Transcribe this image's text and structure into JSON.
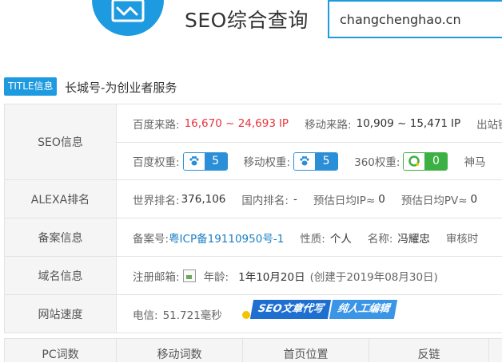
{
  "header": {
    "app_title": "SEO综合查询",
    "search_value": "changchenghao.cn"
  },
  "site": {
    "title_badge": "TITLE信息",
    "title": "长城号-为创业者服务"
  },
  "seo": {
    "label": "SEO信息",
    "baidu_source_label": "百度来路:",
    "baidu_source_value": "16,670 ~ 24,693",
    "baidu_source_unit": "IP",
    "mobile_source_label": "移动来路:",
    "mobile_source_value": "10,909 ~ 15,471",
    "mobile_source_unit": "IP",
    "exit_label": "出站链",
    "baidu_weight_label": "百度权重:",
    "baidu_weight_value": "5",
    "mobile_weight_label": "移动权重:",
    "mobile_weight_value": "5",
    "so360_weight_label": "360权重:",
    "so360_weight_value": "0",
    "shenma_label": "神马"
  },
  "alexa": {
    "label": "ALEXA排名",
    "world_label": "世界排名:",
    "world_value": "376,106",
    "domestic_label": "国内排名:",
    "domestic_value": "-",
    "ip_label": "预估日均IP≈",
    "ip_value": "0",
    "pv_label": "预估日均PV≈",
    "pv_value": "0"
  },
  "beian": {
    "label": "备案信息",
    "number_label": "备案号:",
    "number_value": "粤ICP备19110950号-1",
    "nature_label": "性质:",
    "nature_value": "个人",
    "name_label": "名称:",
    "name_value": "冯耀忠",
    "audit_label": "审核时"
  },
  "domain": {
    "label": "域名信息",
    "email_label": "注册邮箱:",
    "age_label": "年龄:",
    "age_value": "1年10月20日",
    "created": "(创建于2019年08月30日)"
  },
  "speed": {
    "label": "网站速度",
    "telecom_label": "电信:",
    "telecom_value": "51.721毫秒"
  },
  "ad": {
    "part1": "SEO文章代写",
    "part2": "纯人工编辑"
  },
  "bottom_table": {
    "columns": [
      "PC词数",
      "移动词数",
      "首页位置",
      "反链"
    ]
  },
  "colors": {
    "accent": "#1e9be0",
    "baidu_blue": "#2b8fd8",
    "so360_green": "#3cb043",
    "traffic_red": "#e8323c"
  }
}
